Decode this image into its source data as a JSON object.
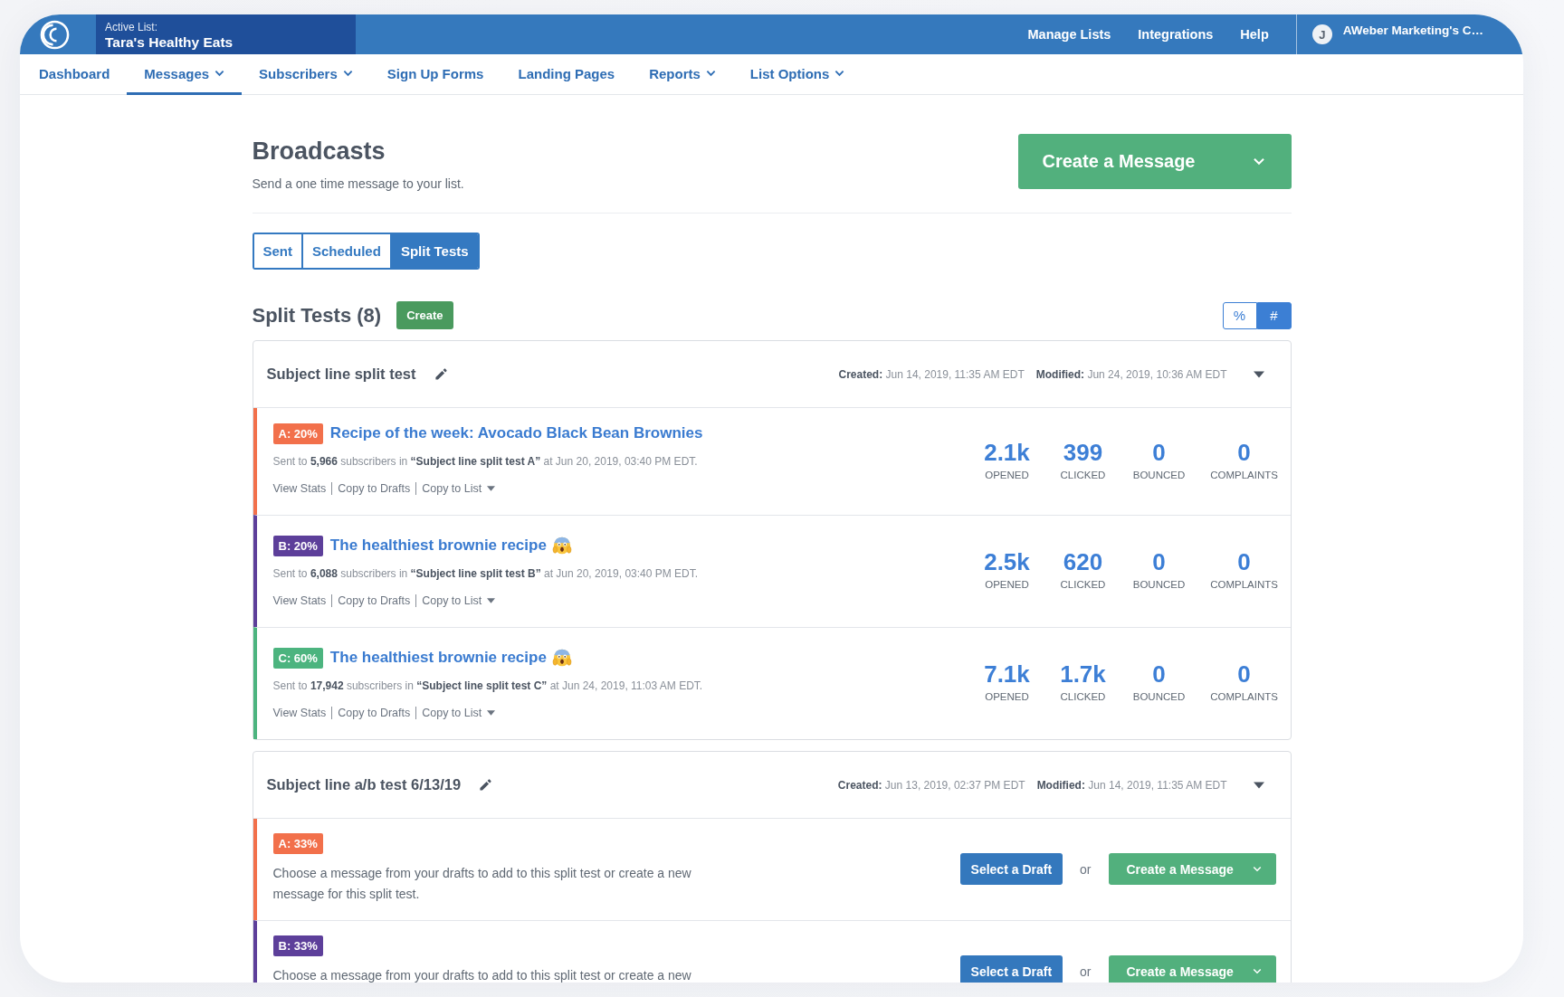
{
  "top_bar": {
    "active_list": {
      "label": "Active List:",
      "name": "Tara's Healthy Eats"
    },
    "links": [
      "Manage Lists",
      "Integrations",
      "Help"
    ],
    "account": {
      "initial": "J",
      "name": "AWeber Marketing's C…"
    }
  },
  "nav": [
    {
      "label": "Dashboard",
      "selected": false,
      "dropdown": false
    },
    {
      "label": "Messages",
      "selected": true,
      "dropdown": true
    },
    {
      "label": "Subscribers",
      "selected": false,
      "dropdown": true
    },
    {
      "label": "Sign Up Forms",
      "selected": false,
      "dropdown": false
    },
    {
      "label": "Landing Pages",
      "selected": false,
      "dropdown": false
    },
    {
      "label": "Reports",
      "selected": false,
      "dropdown": true
    },
    {
      "label": "List Options",
      "selected": false,
      "dropdown": true
    }
  ],
  "header": {
    "title": "Broadcasts",
    "subtitle": "Send a one time message to your list.",
    "create_button": "Create a Message"
  },
  "tabs": [
    {
      "label": "Sent",
      "selected": false
    },
    {
      "label": "Scheduled",
      "selected": false
    },
    {
      "label": "Split Tests",
      "selected": true
    }
  ],
  "split_tests_header": {
    "title": "Split Tests (8)",
    "create_button": "Create",
    "view_toggle": [
      {
        "label": "%",
        "selected": false
      },
      {
        "label": "#",
        "selected": true
      }
    ]
  },
  "split_tests": [
    {
      "name": "Subject line split test",
      "created": "**Created:** Jun 14, 2019, 11:35 AM EDT",
      "modified": "**Modified:** Jun 24, 2019, 10:36 AM EDT",
      "variants": [
        {
          "kind": "sent",
          "badge": "A: 20%",
          "color": "#f2704b",
          "title": "Recipe of the week: Avocado Black Bean Brownies",
          "emoji": false,
          "sent_text": "Sent to **5,966** subscribers in **“Subject line split test A”** at Jun 20, 2019, 03:40 PM EDT.",
          "links": [
            {
              "label": "View Stats",
              "dropdown": false
            },
            {
              "label": "Copy to Drafts",
              "dropdown": false
            },
            {
              "label": "Copy to List",
              "dropdown": true
            }
          ],
          "stats": [
            {
              "value": "2.1k",
              "label": "OPENED"
            },
            {
              "value": "399",
              "label": "CLICKED"
            },
            {
              "value": "0",
              "label": "BOUNCED"
            },
            {
              "value": "0",
              "label": "COMPLAINTS"
            }
          ]
        },
        {
          "kind": "sent",
          "badge": "B: 20%",
          "color": "#5d3f9a",
          "title": "The healthiest brownie recipe",
          "emoji": true,
          "sent_text": "Sent to **6,088** subscribers in **“Subject line split test B”** at Jun 20, 2019, 03:40 PM EDT.",
          "links": [
            {
              "label": "View Stats",
              "dropdown": false
            },
            {
              "label": "Copy to Drafts",
              "dropdown": false
            },
            {
              "label": "Copy to List",
              "dropdown": true
            }
          ],
          "stats": [
            {
              "value": "2.5k",
              "label": "OPENED"
            },
            {
              "value": "620",
              "label": "CLICKED"
            },
            {
              "value": "0",
              "label": "BOUNCED"
            },
            {
              "value": "0",
              "label": "COMPLAINTS"
            }
          ]
        },
        {
          "kind": "sent",
          "badge": "C: 60%",
          "color": "#4cb47f",
          "title": "The healthiest brownie recipe",
          "emoji": true,
          "sent_text": "Sent to **17,942** subscribers in **“Subject line split test C”** at Jun 24, 2019, 11:03 AM EDT.",
          "links": [
            {
              "label": "View Stats",
              "dropdown": false
            },
            {
              "label": "Copy to Drafts",
              "dropdown": false
            },
            {
              "label": "Copy to List",
              "dropdown": true
            }
          ],
          "stats": [
            {
              "value": "7.1k",
              "label": "OPENED"
            },
            {
              "value": "1.7k",
              "label": "CLICKED"
            },
            {
              "value": "0",
              "label": "BOUNCED"
            },
            {
              "value": "0",
              "label": "COMPLAINTS"
            }
          ]
        }
      ]
    },
    {
      "name": "Subject line a/b test 6/13/19",
      "created": "**Created:** Jun 13, 2019, 02:37 PM EDT",
      "modified": "**Modified:** Jun 14, 2019, 11:35 AM EDT",
      "variants": [
        {
          "kind": "draft",
          "badge": "A: 33%",
          "color": "#f2704b",
          "text": "Choose a message from your drafts to add to this split test or create a new message for this split test.",
          "select_button": "Select a Draft",
          "or": "or",
          "create_button": "Create a Message"
        },
        {
          "kind": "draft",
          "badge": "B: 33%",
          "color": "#5d3f9a",
          "text": "Choose a message from your drafts to add to this split test or create a new",
          "select_button": "Select a Draft",
          "or": "or",
          "create_button": "Create a Message"
        }
      ]
    }
  ]
}
